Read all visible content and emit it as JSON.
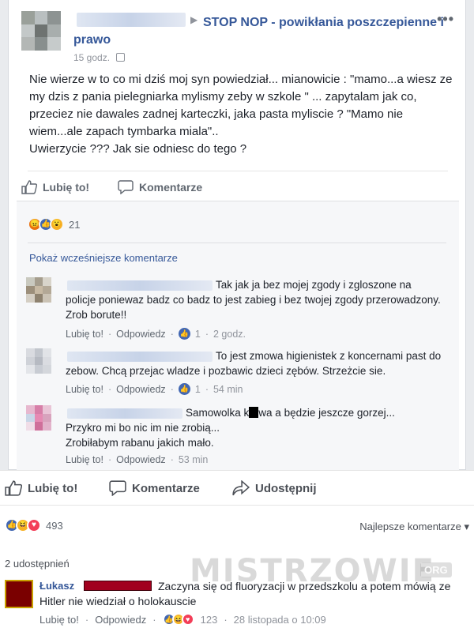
{
  "post": {
    "group_title": "STOP NOP - powikłania poszczepienne i prawo",
    "more": "•••",
    "time": "15 godz.",
    "text": "Nie wierze w to co mi dziś moj syn powiedział... mianowicie : \"mamo...a wiesz ze my dzis z pania pielegniarka mylismy zeby w szkole \" ... zapytalam jak co, przeciez nie dawales zadnej karteczki, jaka pasta myliscie ? \"Mamo nie wiem...ale zapach tymbarka miala\"..\nUwierzycie ??? Jak sie odniesc do tego ?",
    "like_label": "Lubię to!",
    "comment_label": "Komentarze",
    "reaction_count": "21"
  },
  "comments": {
    "prev_link": "Pokaż wcześniejsze komentarze",
    "items": [
      {
        "text": "Tak jak ja bez mojej zgody i zgloszone na policje poniewaz badz co badz to jest zabieg i bez twojej zgody przerowadzony. Zrob borute!!",
        "like": "Lubię to!",
        "reply": "Odpowiedz",
        "likes": "1",
        "time": "2 godz."
      },
      {
        "text": "To jest zmowa higienistek z koncernami past do zebow. Chcą przejac wladze i pozbawic dzieci zębów. Strzeżcie sie.",
        "like": "Lubię to!",
        "reply": "Odpowiedz",
        "likes": "1",
        "time": "54 min"
      },
      {
        "text_a": "Samowolka k",
        "text_b": "wa a będzie jeszcze gorzej...",
        "text_c": "Przykro mi bo nic im nie zrobią...\nZrobiłabym rabanu jakich mało.",
        "like": "Lubię to!",
        "reply": "Odpowiedz",
        "time": "53 min"
      }
    ]
  },
  "share_bar": {
    "like": "Lubię to!",
    "comment": "Komentarze",
    "share": "Udostępnij"
  },
  "bottom": {
    "reaction_count": "493",
    "sort_label": "Najlepsze komentarze",
    "shares": "2 udostępnień",
    "comment": {
      "author": "Łukasz",
      "text": "Zaczyna się od fluoryzacji w przedszkolu a potem mówią ze Hitler nie wiedział o holokauscie",
      "like": "Lubię to!",
      "reply": "Odpowiedz",
      "reaction_count": "123",
      "time": "28 listopada o 10:09"
    }
  },
  "watermark": {
    "text": "MISTRZOWIE",
    "badge": "ORG"
  }
}
